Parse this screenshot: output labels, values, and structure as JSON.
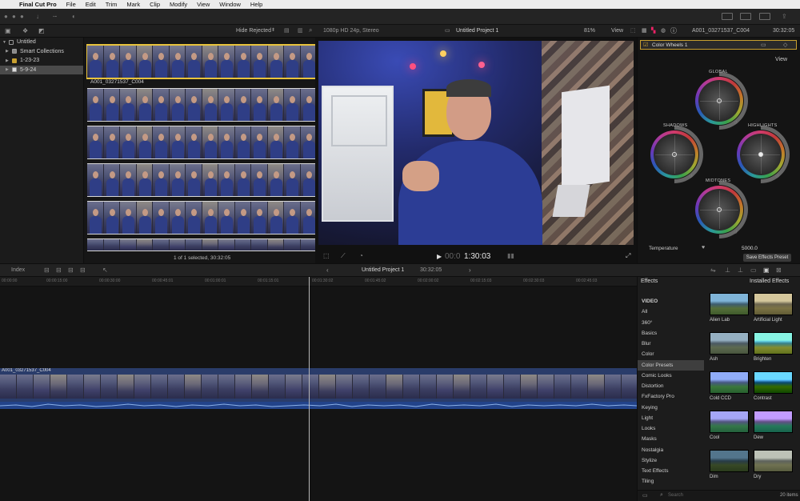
{
  "menubar": {
    "apple": "",
    "app": "Final Cut Pro",
    "items": [
      "File",
      "Edit",
      "Trim",
      "Mark",
      "Clip",
      "Modify",
      "View",
      "Window",
      "Help"
    ]
  },
  "browser_header": {
    "filter": "Hide Rejected",
    "format": "1080p HD 24p, Stereo"
  },
  "library": {
    "items": [
      {
        "label": "Untitled",
        "expanded": true
      },
      {
        "label": "Smart Collections"
      },
      {
        "label": "1-23-23"
      },
      {
        "label": "5-9-24",
        "selected": true
      }
    ]
  },
  "browser": {
    "clip_name": "A001_03271537_C004",
    "status": "1 of 1 selected, 30:32:05"
  },
  "viewer": {
    "project": "Untitled Project 1",
    "zoom": "81%",
    "view_label": "View",
    "timecode_dim": "00:0",
    "timecode": "1:30:03"
  },
  "inspector": {
    "clip_name": "A001_03271537_C004",
    "duration": "30:32:05",
    "effect": "Color Wheels 1",
    "view_label": "View",
    "wheels": {
      "global": "GLOBAL",
      "shadows": "SHADOWS",
      "highlights": "HIGHLIGHTS",
      "midtones": "MIDTONES"
    },
    "temperature_label": "Temperature",
    "temperature_value": "5000.0",
    "save_preset": "Save Effects Preset"
  },
  "timeline_bar": {
    "index": "Index",
    "project": "Untitled Project 1",
    "duration": "30:32:05"
  },
  "ruler_ticks": [
    "00:00:00",
    "00:00:15:00",
    "00:00:30:00",
    "00:00:45:01",
    "00:01:00:01",
    "00:01:15:01",
    "00:01:30:02",
    "00:01:45:02",
    "00:02:00:02",
    "00:02:15:03",
    "00:02:30:03",
    "00:02:45:03"
  ],
  "timeline": {
    "clip_name": "A001_03271537_C004"
  },
  "effects": {
    "title": "Effects",
    "installed": "Installed Effects",
    "categories": [
      "VIDEO",
      "All",
      "360°",
      "Basics",
      "Blur",
      "Color",
      "Color Presets",
      "Comic Looks",
      "Distortion",
      "FxFactory Pro",
      "Keying",
      "Light",
      "Looks",
      "Masks",
      "Nostalgia",
      "Stylize",
      "Text Effects",
      "Tiling"
    ],
    "selected_category": "Color Presets",
    "thumbnails": [
      "Alien Lab",
      "Artificial Light",
      "Ash",
      "Brighten",
      "Cold CCD",
      "Contrast",
      "Cool",
      "Dew",
      "Dim",
      "Dry"
    ],
    "search_placeholder": "Search",
    "count": "20 items"
  },
  "colors": {
    "selection_yellow": "#e8c33c",
    "clip_blue": "#2a3c6a",
    "audio_blue": "#22438a"
  }
}
